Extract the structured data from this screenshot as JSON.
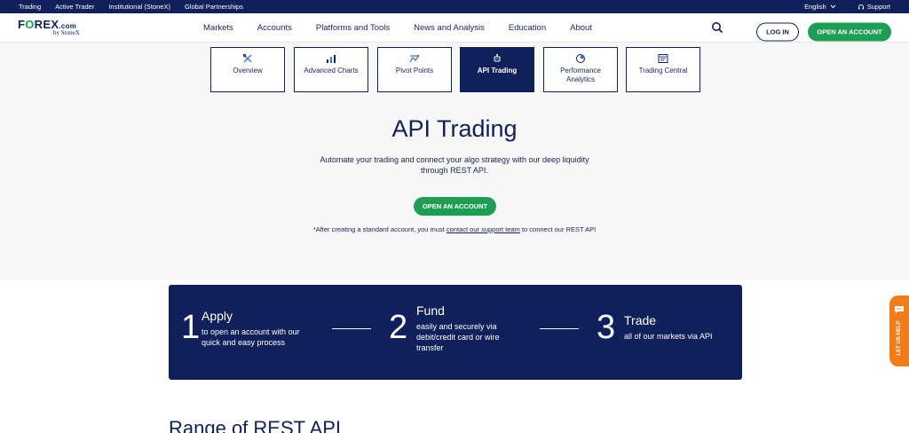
{
  "topbar": {
    "left_links": [
      "Trading",
      "Active Trader",
      "Institutional (StoneX)",
      "Global Partnerships"
    ],
    "language": "English",
    "support": "Support"
  },
  "logo": {
    "brand_f": "F",
    "brand_o": "O",
    "brand_rest": "REX",
    "brand_com": ".com",
    "by": "by StoneX"
  },
  "nav": {
    "items": [
      "Markets",
      "Accounts",
      "Platforms and Tools",
      "News and Analysis",
      "Education",
      "About"
    ],
    "login": "LOG IN",
    "open_account": "OPEN AN ACCOUNT"
  },
  "tiles": [
    {
      "label": "Overview",
      "icon": "tools-icon"
    },
    {
      "label": "Advanced Charts",
      "icon": "chart-icon"
    },
    {
      "label": "Pivot Points",
      "icon": "pivot-icon"
    },
    {
      "label": "API Trading",
      "icon": "robot-icon"
    },
    {
      "label_line1": "Performance",
      "label_line2": "Analytics",
      "icon": "analytics-icon"
    },
    {
      "label": "Trading Central",
      "icon": "dashboard-icon"
    }
  ],
  "hero": {
    "title": "API Trading",
    "sub_line1": "Automate your trading and connect your algo strategy with our deep liquidity",
    "sub_line2": "through REST API.",
    "cta": "OPEN AN ACCOUNT",
    "note_before": "*After creating a standard account, you must ",
    "note_link": "contact our support team",
    "note_after": " to connect our REST API"
  },
  "steps": [
    {
      "num": "1",
      "title": "Apply",
      "desc": [
        "to open an account with our",
        "quick and easy process"
      ]
    },
    {
      "num": "2",
      "title": "Fund",
      "desc": [
        "easily and securely via",
        "debit/credit card or wire",
        "transfer"
      ]
    },
    {
      "num": "3",
      "title": "Trade",
      "desc": [
        "all of our markets via API"
      ]
    }
  ],
  "range_heading": "Range of REST API",
  "help_tab": "LET US HELP",
  "colors": {
    "navy": "#10205a",
    "green": "#1f9d55",
    "orange": "#f07d1a"
  }
}
